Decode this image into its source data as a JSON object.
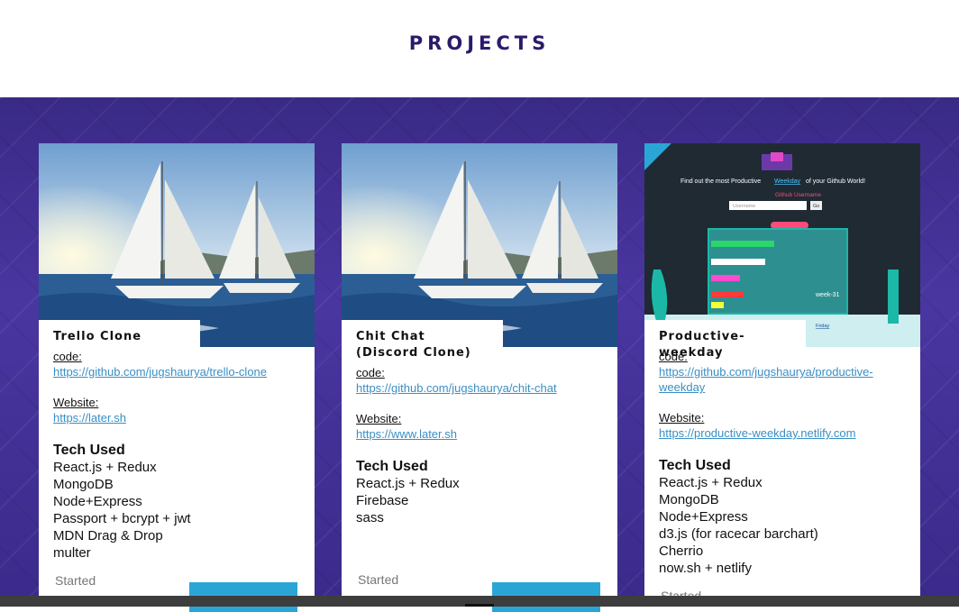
{
  "header": {
    "title": "PROJECTS"
  },
  "projects": [
    {
      "name_lines": [
        "Trello Clone"
      ],
      "code_label": "code:",
      "code_url": "https://github.com/jugshaurya/trello-clone",
      "website_label": "Website:",
      "website_url": "https://later.sh",
      "tech_title": "Tech Used",
      "tech": [
        "React.js + Redux",
        "MongoDB",
        "Node+Express",
        "Passport + bcrypt + jwt",
        "MDN Drag & Drop",
        "multer"
      ],
      "started_label": "Started",
      "image": "sailboats-photo"
    },
    {
      "name_lines": [
        "Chit Chat",
        "(Discord Clone)"
      ],
      "code_label": "code:",
      "code_url": "https://github.com/jugshaurya/chit-chat",
      "website_label": "Website:",
      "website_url": "https://www.later.sh",
      "tech_title": "Tech Used",
      "tech": [
        "React.js + Redux",
        "Firebase",
        "sass"
      ],
      "started_label": "Started",
      "image": "sailboats-photo"
    },
    {
      "name_lines": [
        "Productive-weekday"
      ],
      "code_label": "code:",
      "code_url_lines": [
        "https://github.com/jugshaurya/productive-",
        "weekday"
      ],
      "website_label": "Website:",
      "website_url": "https://productive-weekday.netlify.com",
      "tech_title": "Tech Used",
      "tech": [
        "React.js + Redux",
        "MongoDB",
        "Node+Express",
        "d3.js (for racecar barchart)",
        "Cherrio",
        "now.sh + netlify"
      ],
      "started_label": "Started",
      "image": "productive-weekday-screenshot",
      "screenshot": {
        "heading_pre": "Find out the most Productive",
        "heading_link": "Weekday",
        "heading_post": "of your Github World!",
        "username_label": "Github Username",
        "username_placeholder": "Username",
        "go_label": "Go",
        "chart_label": "week-31",
        "answer_day": "Friday"
      }
    }
  ],
  "colors": {
    "brand": "#2b1a6b",
    "link": "#3a8fc4",
    "button": "#2aa6d6"
  }
}
